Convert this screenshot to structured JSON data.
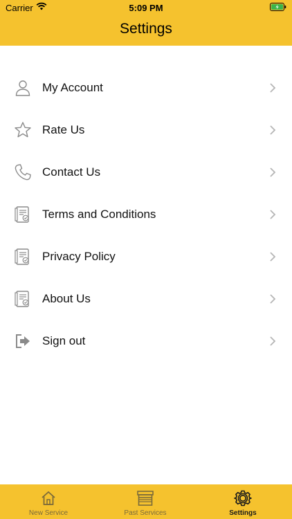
{
  "status_bar": {
    "carrier": "Carrier",
    "time": "5:09 PM"
  },
  "header": {
    "title": "Settings"
  },
  "colors": {
    "accent": "#F5C22E",
    "icon_gray": "#8a8a8a",
    "chevron": "#b5b5b5"
  },
  "settings_items": [
    {
      "label": "My Account",
      "icon": "user-icon"
    },
    {
      "label": "Rate Us",
      "icon": "star-icon"
    },
    {
      "label": "Contact Us",
      "icon": "phone-icon"
    },
    {
      "label": "Terms and Conditions",
      "icon": "document-icon"
    },
    {
      "label": "Privacy Policy",
      "icon": "document-icon"
    },
    {
      "label": "About Us",
      "icon": "document-icon"
    },
    {
      "label": "Sign out",
      "icon": "sign-out-icon"
    }
  ],
  "tabbar": {
    "tabs": [
      {
        "label": "New Service",
        "icon": "home-icon",
        "active": false
      },
      {
        "label": "Past Services",
        "icon": "store-icon",
        "active": false
      },
      {
        "label": "Settings",
        "icon": "gear-icon",
        "active": true
      }
    ]
  }
}
